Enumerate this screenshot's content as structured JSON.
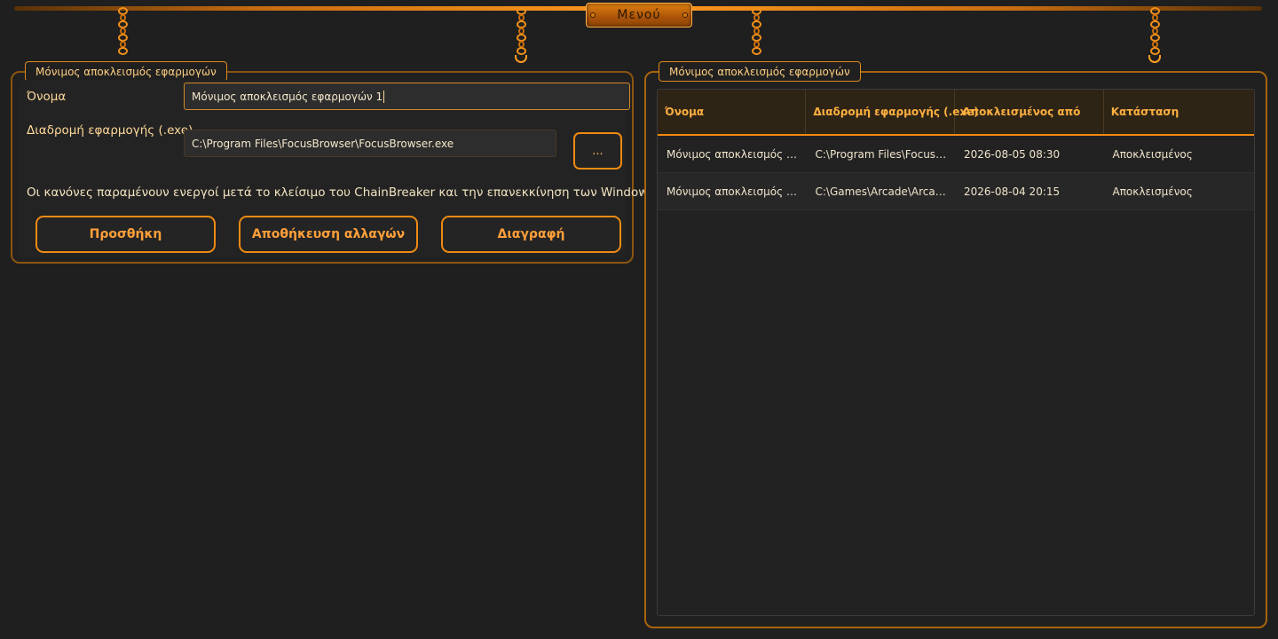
{
  "menu": {
    "label": "Μενού"
  },
  "editor": {
    "legend": "Μόνιμος αποκλεισμός εφαρμογών",
    "name_label": "Όνομα",
    "name_value": "Μόνιμος αποκλεισμός εφαρμογών 1",
    "path_label": "Διαδρομή εφαρμογής (.exe)",
    "path_value": "C:\\Program Files\\FocusBrowser\\FocusBrowser.exe",
    "browse_label": "...",
    "note": "Οι κανόνες παραμένουν ενεργοί μετά το κλείσιμο του ChainBreaker και την επανεκκίνηση των Windows.",
    "add_label": "Προσθήκη",
    "save_label": "Αποθήκευση αλλαγών",
    "delete_label": "Διαγραφή"
  },
  "list": {
    "legend": "Μόνιμος αποκλεισμός εφαρμογών",
    "columns": [
      "Όνομα",
      "Διαδρομή εφαρμογής (.exe)",
      "Αποκλεισμένος από",
      "Κατάσταση"
    ],
    "rows": [
      {
        "name": "Μόνιμος αποκλεισμός εφ...",
        "path": "C:\\Program Files\\FocusBr...",
        "since": "2026-08-05 08:30",
        "status": "Αποκλεισμένος"
      },
      {
        "name": "Μόνιμος αποκλεισμός εφ...",
        "path": "C:\\Games\\Arcade\\Arcade....",
        "since": "2026-08-04 20:15",
        "status": "Αποκλεισμένος"
      }
    ]
  },
  "colors": {
    "accent": "#f08a12",
    "background": "#1f1f1f",
    "text": "#f2e3c0"
  }
}
